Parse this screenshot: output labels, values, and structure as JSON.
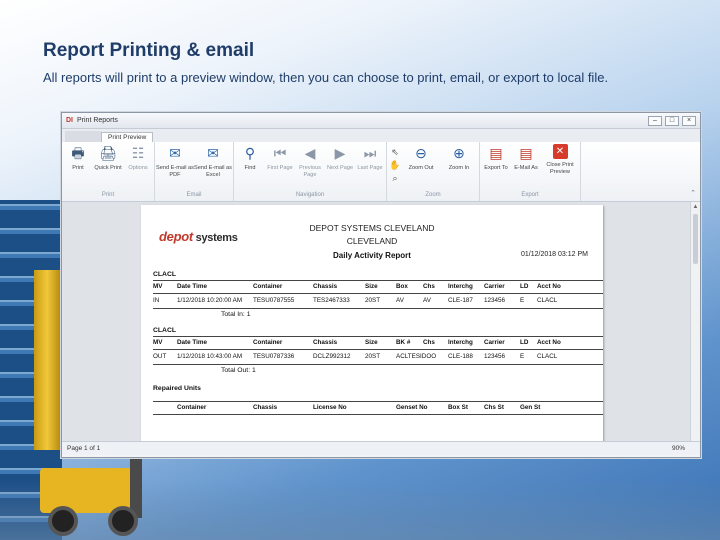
{
  "slide": {
    "title": "Report Printing & email",
    "subtitle": "All reports will print to a preview window, then you can choose to print, email, or export to local file."
  },
  "window": {
    "logo": "DI",
    "title": "Print Reports",
    "controls": [
      "–",
      "□",
      "×"
    ],
    "tabs": {
      "file": "",
      "active": "Print Preview"
    }
  },
  "ribbon": {
    "groups": {
      "print": {
        "caption": "Print",
        "print": "Print",
        "quick_print": "Quick Print",
        "options": "Options"
      },
      "email": {
        "caption": "Email",
        "send_pdf": "Send E-mail as PDF",
        "send_excel": "Send E-mail as Excel"
      },
      "navigation": {
        "caption": "Navigation",
        "find": "Find",
        "first_page": "First Page",
        "previous_page": "Previous Page",
        "next_page": "Next Page",
        "last_page": "Last Page"
      },
      "zoom": {
        "caption": "Zoom",
        "zoom_out": "Zoom Out",
        "zoom_in": "Zoom In"
      },
      "export": {
        "caption": "Export",
        "export_to": "Export To",
        "email_as": "E-Mail As",
        "close_preview": "Close Print Preview"
      }
    }
  },
  "report": {
    "logo_brand": "depot",
    "logo_suffix": " systems",
    "company": "DEPOT SYSTEMS CLEVELAND",
    "city": "CLEVELAND",
    "title": "Daily Activity Report",
    "datetime": "01/12/2018 03:12 PM",
    "sections": [
      {
        "label": "CLACL",
        "headers": [
          "MV",
          "Date Time",
          "Container",
          "Chassis",
          "Size",
          "Box",
          "Chs",
          "Interchg",
          "Carrier",
          "LD",
          "Acct No"
        ],
        "row": [
          "IN",
          "1/12/2018 10:20:00 AM",
          "TESU0787555",
          "TES2467333",
          "20ST",
          "AV",
          "AV",
          "CLE-187",
          "123456",
          "E",
          "CLACL"
        ],
        "total": "Total In: 1"
      },
      {
        "label": "CLACL",
        "headers": [
          "MV",
          "Date Time",
          "Container",
          "Chassis",
          "Size",
          "BK #",
          "Chs",
          "Interchg",
          "Carrier",
          "LD",
          "Acct No"
        ],
        "row": [
          "OUT",
          "1/12/2018 10:43:00 AM",
          "TESU0787336",
          "DCLZ992312",
          "20ST",
          "ACLTESIDOO",
          "",
          "CLE-188",
          "123456",
          "E",
          "CLACL"
        ],
        "total": "Total Out: 1"
      }
    ],
    "repaired_label": "Repaired Units",
    "repaired_headers": [
      "Container",
      "Chassis",
      "License No",
      "Genset No",
      "Box St",
      "Chs St",
      "Gen St"
    ]
  },
  "status": {
    "page": "Page 1 of 1",
    "zoom": "90%"
  }
}
